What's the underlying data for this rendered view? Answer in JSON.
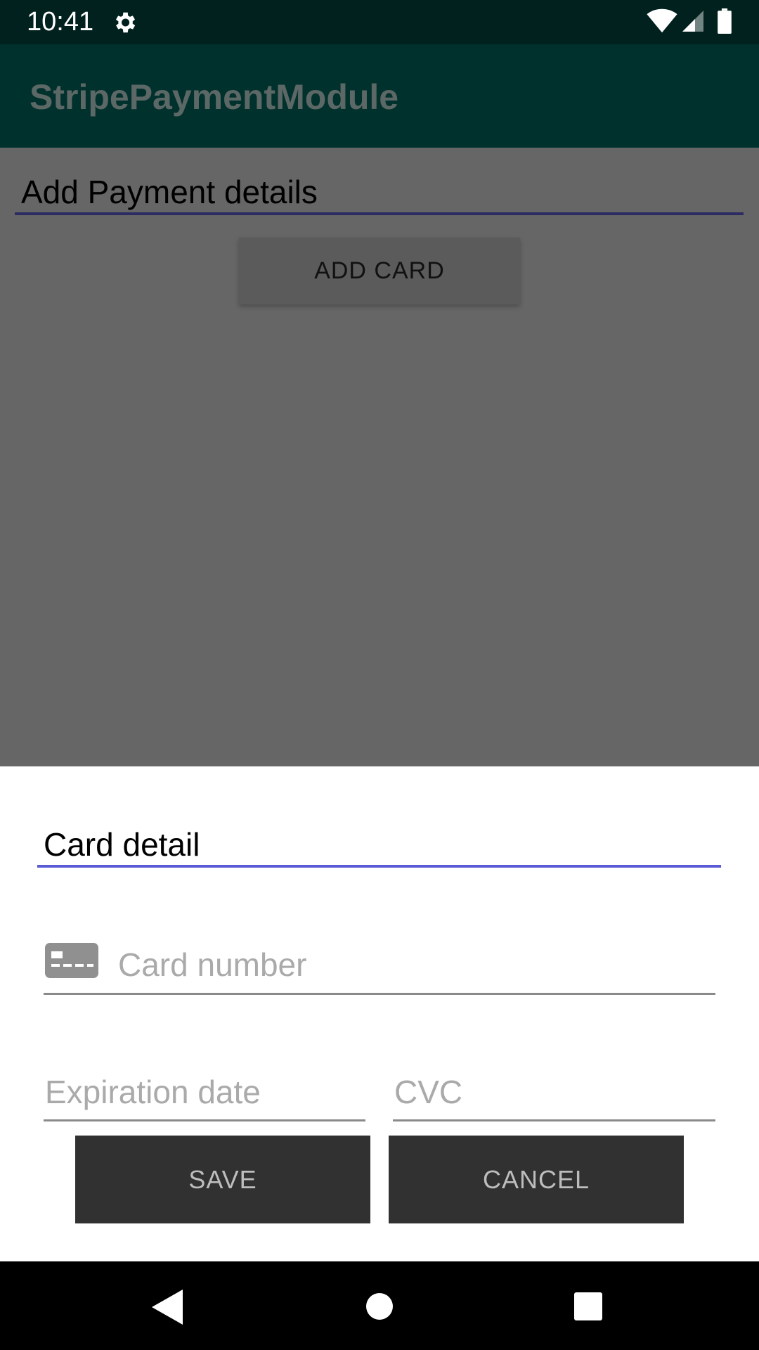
{
  "status_bar": {
    "time": "10:41",
    "icons": [
      "gear-icon",
      "wifi-icon",
      "cell-signal-icon",
      "battery-icon"
    ]
  },
  "app_bar": {
    "title": "StripePaymentModule"
  },
  "main": {
    "payment_field_value": "Add Payment details",
    "add_card_label": "ADD CARD"
  },
  "dialog": {
    "card_detail_value": "Card detail",
    "card_number_placeholder": "Card number",
    "card_icon": "credit-card-icon",
    "expiration_placeholder": "Expiration date",
    "cvc_placeholder": "CVC",
    "save_label": "SAVE",
    "cancel_label": "CANCEL"
  },
  "nav_bar": {
    "icons": [
      "back-icon",
      "home-icon",
      "recents-icon"
    ]
  },
  "colors": {
    "status_bar": "#00211e",
    "app_bar": "#00312d",
    "scrim_background": "#666666",
    "accent_underline": "#5c5bd6",
    "dialog_button": "#313131"
  }
}
